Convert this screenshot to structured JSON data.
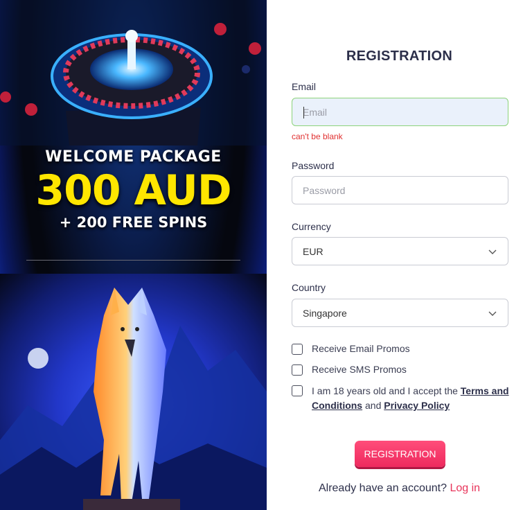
{
  "promo": {
    "line1": "WELCOME PACKAGE",
    "line2": "300 AUD",
    "line3": "+ 200 FREE SPINS"
  },
  "form": {
    "title": "REGISTRATION",
    "email": {
      "label": "Email",
      "placeholder": "Email",
      "error": "can't be blank"
    },
    "password": {
      "label": "Password",
      "placeholder": "Password"
    },
    "currency": {
      "label": "Currency",
      "value": "EUR"
    },
    "country": {
      "label": "Country",
      "value": "Singapore"
    },
    "checks": {
      "email_promos": "Receive Email Promos",
      "sms_promos": "Receive SMS Promos",
      "terms_prefix": "I am 18 years old and I accept the ",
      "terms_link": "Terms and Conditions",
      "terms_and": " and ",
      "privacy_link": "Privacy Policy"
    },
    "submit": "REGISTRATION",
    "login_prompt": "Already have an account? ",
    "login_link": "Log in"
  },
  "colors": {
    "accent": "#ee2a5e",
    "promo_yellow": "#ffe600",
    "error": "#e03030"
  }
}
